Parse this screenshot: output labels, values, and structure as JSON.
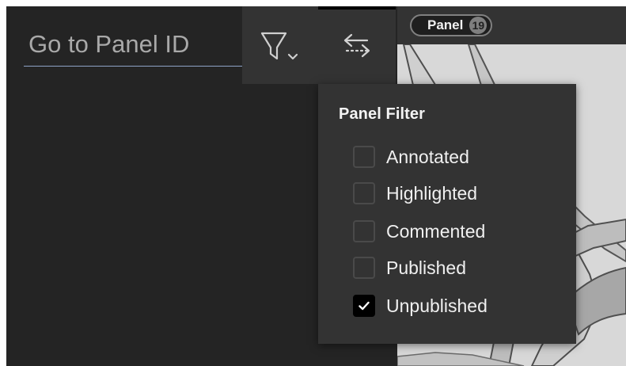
{
  "search": {
    "placeholder": "Go to Panel ID",
    "value": ""
  },
  "toolbar": {
    "filter_icon": "filter-icon",
    "swap_icon": "swap-arrows-icon"
  },
  "panel_badge": {
    "label": "Panel",
    "count": "19"
  },
  "filter_menu": {
    "title": "Panel Filter",
    "items": [
      {
        "label": "Annotated",
        "checked": false
      },
      {
        "label": "Highlighted",
        "checked": false
      },
      {
        "label": "Commented",
        "checked": false
      },
      {
        "label": "Published",
        "checked": false
      },
      {
        "label": "Unpublished",
        "checked": true
      }
    ]
  },
  "colors": {
    "background": "#242424",
    "panel": "#333333",
    "text": "#f0f0f0",
    "accent_underline": "#8ea3c5"
  }
}
